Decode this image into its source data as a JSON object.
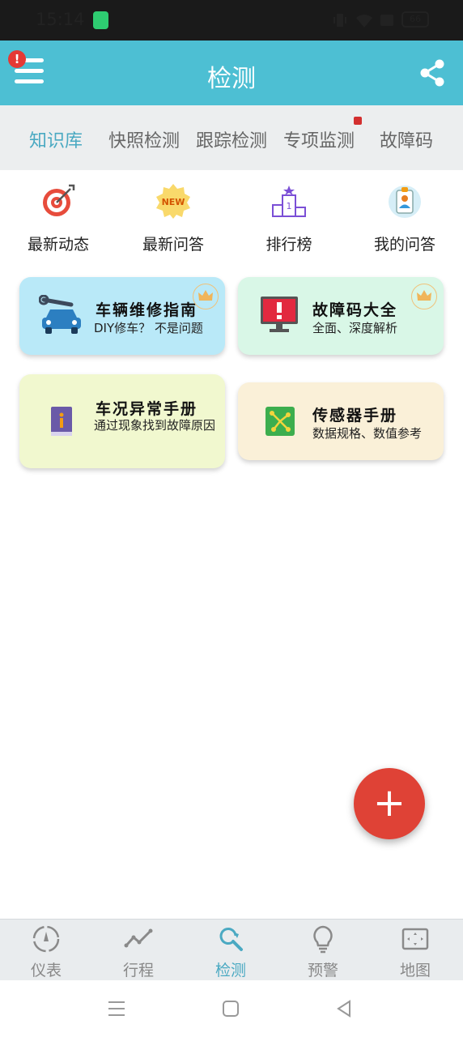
{
  "status_bar": {
    "time": "15:14",
    "battery": "66"
  },
  "app_bar": {
    "title": "检测",
    "alert_badge": "!"
  },
  "tabs": [
    {
      "label": "知识库",
      "active": true
    },
    {
      "label": "快照检测",
      "active": false
    },
    {
      "label": "跟踪检测",
      "active": false
    },
    {
      "label": "专项监测",
      "active": false
    },
    {
      "label": "故障码",
      "active": false
    }
  ],
  "quick_actions": [
    {
      "label": "最新动态",
      "icon": "target-icon"
    },
    {
      "label": "最新问答",
      "icon": "new-badge-icon",
      "badge": "NEW"
    },
    {
      "label": "排行榜",
      "icon": "podium-icon",
      "rank": "1"
    },
    {
      "label": "我的问答",
      "icon": "id-card-icon"
    }
  ],
  "cards": [
    {
      "title": "车辆维修指南",
      "subtitle": "DIY修车？ 不是问题",
      "icon": "car-wrench-icon",
      "color": "#b9e9f8",
      "crown": true
    },
    {
      "title": "故障码大全",
      "subtitle": "全面、深度解析",
      "icon": "monitor-alert-icon",
      "color": "#d9f7e7",
      "crown": true
    },
    {
      "title": "车况异常手册",
      "subtitle": "通过现象找到故障原因",
      "icon": "info-book-icon",
      "color": "#f1f8cf",
      "crown": false
    },
    {
      "title": "传感器手册",
      "subtitle": "数据规格、数值参考",
      "icon": "circuit-icon",
      "color": "#faf0d8",
      "crown": false
    }
  ],
  "fab": {
    "label": "+"
  },
  "bottom_nav": [
    {
      "label": "仪表",
      "icon": "gauge-icon",
      "active": false
    },
    {
      "label": "行程",
      "icon": "trend-icon",
      "active": false
    },
    {
      "label": "检测",
      "icon": "search-refresh-icon",
      "active": true
    },
    {
      "label": "预警",
      "icon": "lightbulb-icon",
      "active": false
    },
    {
      "label": "地图",
      "icon": "map-frame-icon",
      "active": false
    }
  ],
  "colors": {
    "primary": "#4dbfd3",
    "accent_text": "#4aa9c2",
    "fab": "#df4236"
  }
}
